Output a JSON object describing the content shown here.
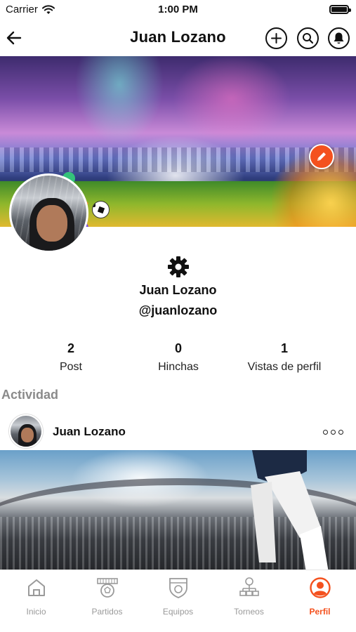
{
  "status_bar": {
    "carrier": "Carrier",
    "time": "1:00 PM"
  },
  "header": {
    "title": "Juan Lozano"
  },
  "profile": {
    "name": "Juan Lozano",
    "handle": "@juanlozano"
  },
  "stats": [
    {
      "value": "2",
      "label": "Post"
    },
    {
      "value": "0",
      "label": "Hinchas"
    },
    {
      "value": "1",
      "label": "Vistas de perfil"
    }
  ],
  "activity": {
    "section_title": "Actividad",
    "post": {
      "author": "Juan Lozano"
    }
  },
  "tabbar": {
    "items": [
      {
        "label": "Inicio",
        "icon": "home-icon"
      },
      {
        "label": "Partidos",
        "icon": "match-icon"
      },
      {
        "label": "Equipos",
        "icon": "shield-icon"
      },
      {
        "label": "Torneos",
        "icon": "bracket-icon"
      },
      {
        "label": "Perfil",
        "icon": "user-icon"
      }
    ],
    "active": "Perfil"
  },
  "colors": {
    "accent": "#f4511e",
    "inactive": "#9a9a9a",
    "muted_heading": "#8a8a8a"
  }
}
